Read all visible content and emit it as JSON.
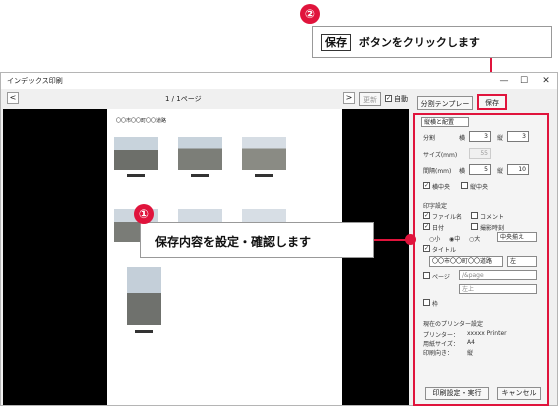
{
  "callout_top": {
    "number": "②",
    "button_word": "保存",
    "text": "ボタンをクリックします"
  },
  "callout_mid": {
    "number": "①",
    "text": "保存内容を設定・確認します"
  },
  "window": {
    "title": "インデックス印刷",
    "min": "—",
    "max": "☐",
    "close": "✕",
    "page_indicator": "1 / 1ページ",
    "prev": "<",
    "next": ">",
    "refresh": "更新",
    "auto_label": "自動",
    "template_button": "分割テンプレート",
    "save_button": "保存"
  },
  "paper": {
    "heading": "〇〇市〇〇町〇〇道路"
  },
  "panel": {
    "order_select": "縦横と配置",
    "division_label": "分割",
    "division_h_label": "横",
    "division_h": "3",
    "division_v_label": "縦",
    "division_v": "3",
    "size_label": "サイズ(mm)",
    "size_value": "55",
    "spacing_label": "間隔(mm)",
    "spacing_h_label": "横",
    "spacing_h": "5",
    "spacing_v_label": "縦",
    "spacing_v": "10",
    "center_h_label": "横中央",
    "center_v_label": "縦中央",
    "print_settings_label": "印字設定",
    "filename_label": "ファイル名",
    "comment_label": "コメント",
    "date_label": "日付",
    "shoot_time_label": "撮影時刻",
    "size_small": "小",
    "size_medium": "中",
    "size_large": "大",
    "align_select": "中央揃え",
    "title_label": "タイトル",
    "title_value": "〇〇市〇〇町〇〇道路",
    "title_align": "左",
    "page_label": "ページ",
    "page_format": "/&page",
    "page_position": "左上",
    "frame_label": "枠",
    "printer_heading": "現在のプリンター設定",
    "printer_label": "プリンター：",
    "printer_value": "xxxxx Printer",
    "paper_size_label": "用紙サイズ：",
    "paper_size_value": "A4",
    "orientation_label": "印刷向き：",
    "orientation_value": "縦"
  },
  "footer": {
    "print_button": "印刷設定・実行",
    "cancel_button": "キャンセル"
  },
  "colors": {
    "accent": "#e0143c"
  }
}
